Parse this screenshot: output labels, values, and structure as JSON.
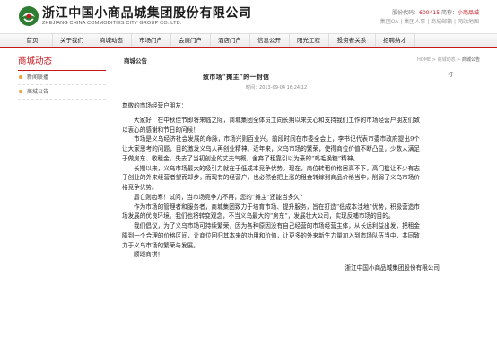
{
  "header": {
    "company_cn": "浙江中国小商品城集团股份有限公司",
    "company_en": "ZHEJIANG CHINA COMMODITIES CITY GROUP CO.,LTD.",
    "stock_label": "股份代码：",
    "stock_code": "600415",
    "stock_abbr_label": "简称：",
    "stock_abbr": "小商品城",
    "links": [
      "集团OA",
      "集团人事",
      "商城邮箱",
      "网站地图"
    ]
  },
  "nav": [
    "首页",
    "关于我们",
    "商城动态",
    "市场门户",
    "会展门户",
    "酒店门户",
    "信息公开",
    "阳光工程",
    "投资者关系",
    "招聘纳才"
  ],
  "sidebar": {
    "title": "商城动态",
    "items": [
      "新闻联播",
      "商城公告"
    ]
  },
  "main": {
    "section_title": "商城公告",
    "breadcrumb": [
      "HOME",
      "商城动态",
      "商城公告"
    ],
    "article_title": "致市场“摊主”的一封信",
    "time_label": "时间：",
    "time": "2013-09-04 16:24:12",
    "print_label": "打"
  },
  "article": {
    "salutation": "尊敬的市场经营户朋友：",
    "paragraphs": [
      "大家好！在中秋佳节即将来临之际，商城集团全体员工向长期以来关心和支持我们工作的市场经营户朋友们致以衷心的感谢和节日的问候！",
      "市场是义乌经济社会发展的命脉，市场兴则百业兴。前段时间在市委全会上，李书记代表市委市政府提出9个让大家思考的问题，目的激发义乌人再创业精神。近年来，义乌市场的繁荣，使得商位价值不断凸显，少数人满足于做房东、收租金，失去了当初创业的丈夫气概，舍弃了租靠引以为豪的“鸡毛换糖”精神。",
      "长期以来，义乌市场最大的吸引力就在于低成本竞争优势。现在，商位转租价格居高不下，高门槛让不少有志于创业的外来经营者望而却步，而现有的经营户，也必然会把上涨的租金转嫁到商品价格当中，削弱了义乌市场价格竞争优势。",
      "唇亡则齿寒！试问，当市场竞争力不再，您的“摊主”还能当多久？",
      "作为市场的管理者和服务者，商城集团致力于培育市场、提升服务，旨在打造“低成本洼地”优势，积极营造市场发展的优良环境。我们也将转变观念，不当义乌最大的“房东”，发展壮大公司，实现反哺市场的目的。",
      "我们倡议，为了义乌市场可持续繁荣，因为各种原因没有自己经营的市场经营主体，从长远利益出发，把租金降到一个合理的价格区间，让商位回归其本来的功用和价值，让更多的外来新生力量加入到市场队伍当中，共同致力于义乌市场的繁荣与发展。",
      "顺颂商祺！"
    ],
    "signature": "浙江中国小商品城集团股份有限公司"
  },
  "colors": {
    "brand_red": "#c8161d",
    "bullet_orange": "#e8a33d"
  }
}
